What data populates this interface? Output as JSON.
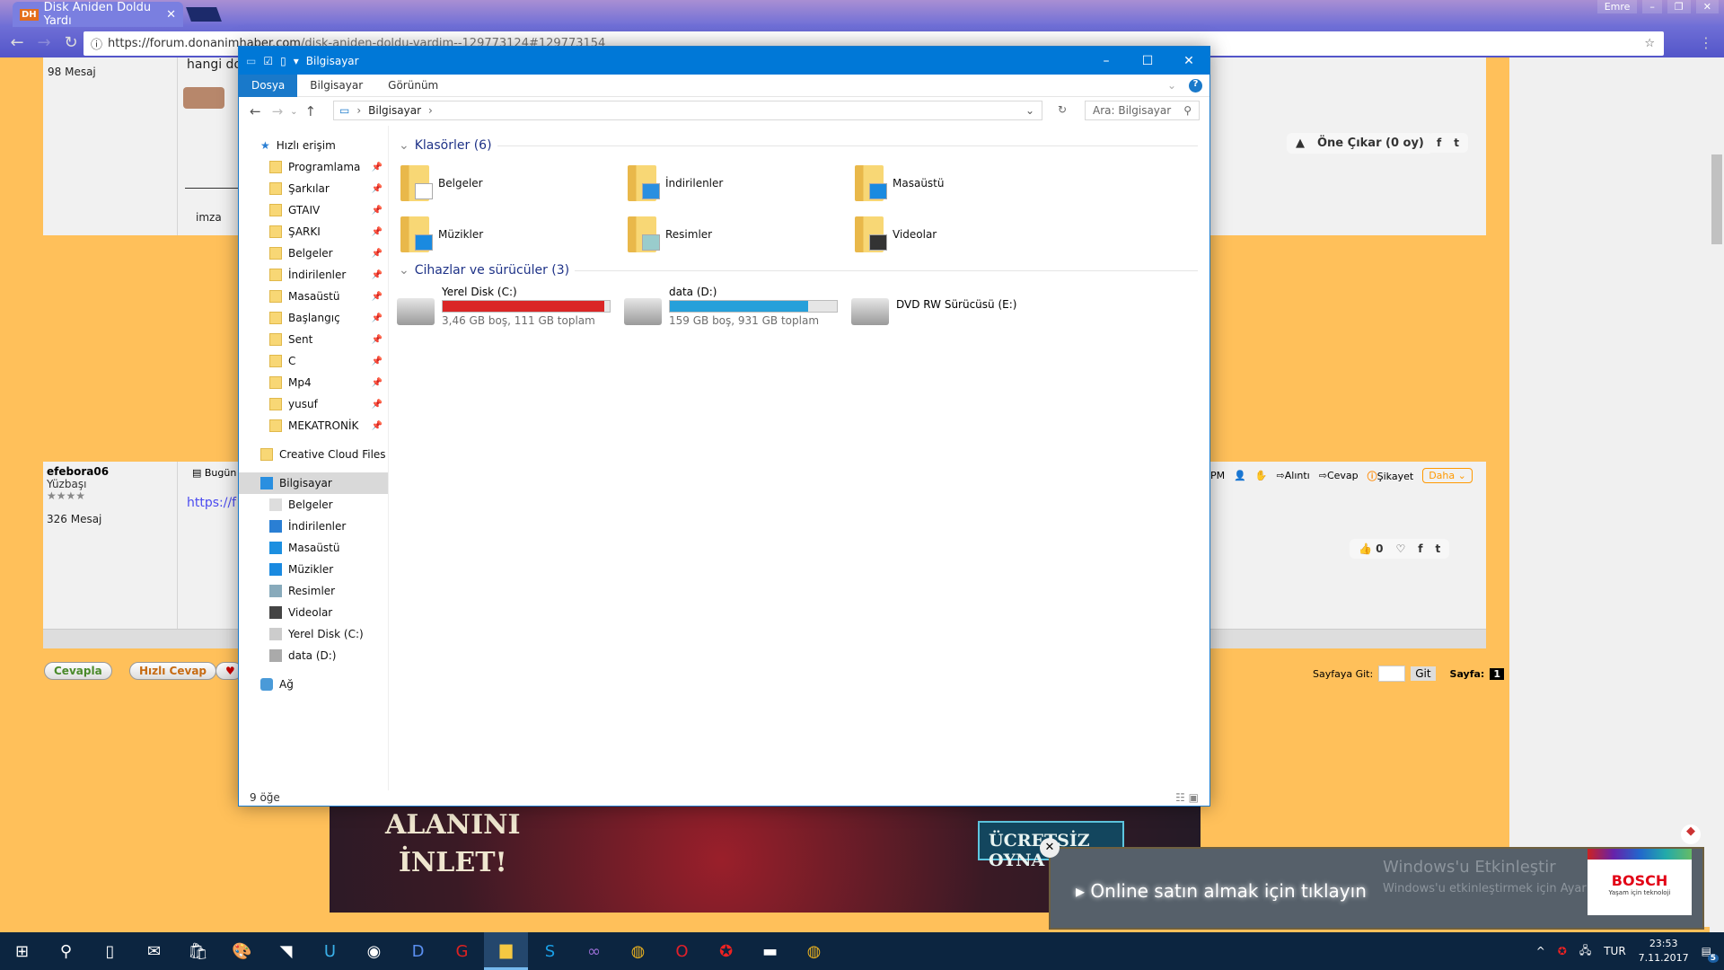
{
  "browser": {
    "tab_title": "Disk Aniden Doldu Yardı",
    "tab_favicon": "DH",
    "url_domain": "https://forum.donanimhaber.com",
    "url_path": "/disk-aniden-doldu-vardim--129773124#129773154",
    "profile_name": "Emre"
  },
  "page": {
    "post1": {
      "message_count": "98 Mesaj",
      "text": "hangi do",
      "signature": "imza",
      "promote": "Öne Çıkar (0 oy)"
    },
    "post2": {
      "username": "efebora06",
      "rank": "Yüzbaşı",
      "stars": 4,
      "message_count": "326 Mesaj",
      "date_prefix": "Bugün",
      "link_text": "https://f",
      "actions": {
        "pm": "PM",
        "quote": "Alıntı",
        "reply": "Cevap",
        "report": "Şikayet",
        "more": "Daha"
      },
      "likes": "0"
    },
    "buttons": {
      "reply": "Cevapla",
      "quick_reply": "Hızlı Cevap"
    },
    "pagination": {
      "goto_label": "Sayfaya Git:",
      "goto_button": "Git",
      "page_label": "Sayfa:",
      "current_page": "1"
    },
    "ad": {
      "headline_1": "ALANINI",
      "headline_2": "İNLET!",
      "cta": "ÜCRETSİZ OYNA"
    }
  },
  "explorer": {
    "title": "Bilgisayar",
    "ribbon_tabs": [
      "Dosya",
      "Bilgisayar",
      "Görünüm"
    ],
    "breadcrumb": "Bilgisayar",
    "search_placeholder": "Ara: Bilgisayar",
    "nav": {
      "quick_access": "Hızlı erişim",
      "pinned": [
        "Programlama",
        "Şarkılar",
        "GTAIV",
        "ŞARKI",
        "Belgeler",
        "İndirilenler",
        "Masaüstü",
        "Başlangıç",
        "Sent",
        "C",
        "Mp4",
        "yusuf",
        "MEKATRONİK"
      ],
      "creative_cloud": "Creative Cloud Files",
      "this_pc": "Bilgisayar",
      "this_pc_children": [
        "Belgeler",
        "İndirilenler",
        "Masaüstü",
        "Müzikler",
        "Resimler",
        "Videolar",
        "Yerel Disk (C:)",
        "data (D:)"
      ],
      "network": "Ağ"
    },
    "folders_header": "Klasörler (6)",
    "folders": [
      "Belgeler",
      "İndirilenler",
      "Masaüstü",
      "Müzikler",
      "Resimler",
      "Videolar"
    ],
    "devices_header": "Cihazlar ve sürücüler (3)",
    "drives": [
      {
        "name": "Yerel Disk (C:)",
        "info": "3,46 GB boş, 111 GB toplam",
        "used_fraction": 0.969,
        "color": "#da2626"
      },
      {
        "name": "data (D:)",
        "info": "159 GB boş, 931 GB toplam",
        "used_fraction": 0.829,
        "color": "#26a0da"
      },
      {
        "name": "DVD RW Sürücüsü (E:)"
      }
    ],
    "status": "9 öğe"
  },
  "toast": {
    "text": "Online satın almak için tıklayın",
    "watermark_title": "Windows'u Etkinleştir",
    "watermark_sub": "Windows'u etkinleştirmek için Ayarlar'a gidin.",
    "brand": "BOSCH",
    "brand_tagline": "Yaşam için teknoloji"
  },
  "taskbar": {
    "apps": [
      "start-icon",
      "search-icon",
      "task-view-icon",
      "mail-icon",
      "store-icon",
      "paint-icon",
      "rss-icon",
      "uplay-icon",
      "steam-icon",
      "devcpp-icon",
      "garena-icon",
      "file-explorer-icon",
      "skype-icon",
      "visual-studio-icon",
      "chrome-icon",
      "opera-icon",
      "app-icon",
      "cmd-icon",
      "chrome-icon"
    ],
    "language": "TUR",
    "time": "23:53",
    "date": "7.11.2017",
    "notifications": "5"
  }
}
